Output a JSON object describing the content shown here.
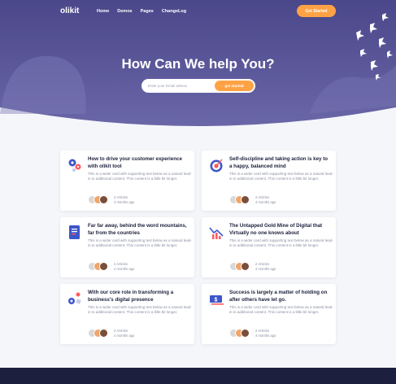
{
  "brand": {
    "logo": "olikit"
  },
  "nav": {
    "items": [
      "Home",
      "Demos",
      "Pages",
      "ChangeLog"
    ],
    "cta": "Get Started"
  },
  "hero": {
    "title": "How Can We help You?",
    "email_placeholder": "Enter your Email adress",
    "subscribe_label": "get started"
  },
  "colors": {
    "primary": "#4d4a8c",
    "accent": "#ffa245",
    "footer": "#1c1f3d"
  },
  "cards": [
    {
      "icon": "gear-icon",
      "title": "How to drive your customer experience with olikit tool",
      "body": "This is a wider card with supporting text below as a natural lead-in to additional content. This content is a little bit longer.",
      "authors": "2 Articles",
      "time": "4 months ago"
    },
    {
      "icon": "target-icon",
      "title": "Self-discipline and taking action is key to a happy, balanced mind",
      "body": "This is a wider card with supporting text below as a natural lead-in to additional content. This content is a little bit longer.",
      "authors": "2 Articles",
      "time": "4 months ago"
    },
    {
      "icon": "document-icon",
      "title": "Far far away, behind the word mountains, far from the countries",
      "body": "This is a wider card with supporting text below as a natural lead-in to additional content. This content is a little bit longer.",
      "authors": "2 Articles",
      "time": "4 months ago"
    },
    {
      "icon": "chart-icon",
      "title": "The Untapped Gold Mine of Digital that Virtually no one knows about",
      "body": "This is a wider card with supporting text below as a natural lead-in to additional content. This content is a little bit longer.",
      "authors": "2 Articles",
      "time": "4 months ago"
    },
    {
      "icon": "shapes-icon",
      "title": "With our core role in transforming a business's digital presence",
      "body": "This is a wider card with supporting text below as a natural lead-in to additional content. This content is a little bit longer.",
      "authors": "2 Articles",
      "time": "4 months ago"
    },
    {
      "icon": "money-icon",
      "title": "Success is largely a matter of holding on after others have let go.",
      "body": "This is a wider card with supporting text below as a natural lead-in to additional content. This content is a little bit longer.",
      "authors": "2 Articles",
      "time": "4 months ago"
    }
  ]
}
